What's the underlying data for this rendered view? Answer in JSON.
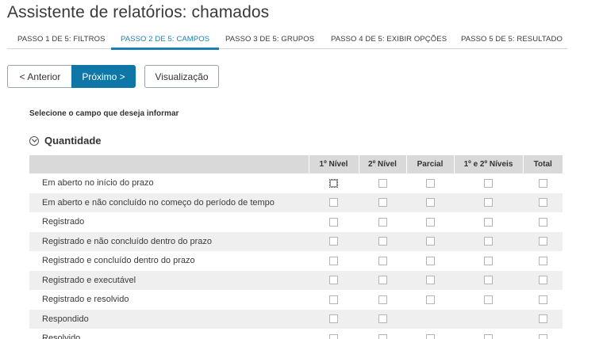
{
  "page": {
    "title": "Assistente de relatórios: chamados"
  },
  "tabs": [
    {
      "label": "PASSO 1 DE 5: FILTROS"
    },
    {
      "label": "PASSO 2 DE 5: CAMPOS"
    },
    {
      "label": "PASSO 3 DE 5: GRUPOS"
    },
    {
      "label": "PASSO 4 DE 5: EXIBIR OPÇÕES"
    },
    {
      "label": "PASSO 5 DE 5: RESULTADO"
    }
  ],
  "active_tab": "PASSO 2 DE 5: CAMPOS",
  "toolbar": {
    "prev_label": "< Anterior",
    "next_label": "Próximo >",
    "view_label": "Visualização"
  },
  "colors": {
    "accent": "#0e77a8",
    "active_tab": "#1a7fb0",
    "header_bg": "#d9d9d9",
    "row_alt": "#efefef"
  },
  "instructions": "Selecione o campo que deseja informar",
  "section": {
    "title": "Quantidade",
    "icon": "chevron-down-circle-icon"
  },
  "table": {
    "headers": [
      "",
      "1º Nível",
      "2º Nível",
      "Parcial",
      "1º e 2º Níveis",
      "Total"
    ],
    "rows": [
      {
        "label": "Em aberto no início do prazo",
        "checks": [
          true,
          true,
          true,
          true,
          true
        ]
      },
      {
        "label": "Em aberto e não concluído no começo do período de tempo",
        "checks": [
          true,
          true,
          true,
          true,
          true
        ]
      },
      {
        "label": "Registrado",
        "checks": [
          true,
          true,
          true,
          true,
          true
        ]
      },
      {
        "label": "Registrado e não concluído dentro do prazo",
        "checks": [
          true,
          true,
          true,
          true,
          true
        ]
      },
      {
        "label": "Registrado e concluído dentro do prazo",
        "checks": [
          true,
          true,
          true,
          true,
          true
        ]
      },
      {
        "label": "Registrado e executável",
        "checks": [
          true,
          true,
          true,
          true,
          true
        ]
      },
      {
        "label": "Registrado e resolvido",
        "checks": [
          true,
          true,
          true,
          true,
          true
        ]
      },
      {
        "label": "Respondido",
        "checks": [
          true,
          true,
          false,
          false,
          true
        ]
      },
      {
        "label": "Resolvido",
        "checks": [
          true,
          true,
          true,
          true,
          true
        ]
      }
    ]
  }
}
